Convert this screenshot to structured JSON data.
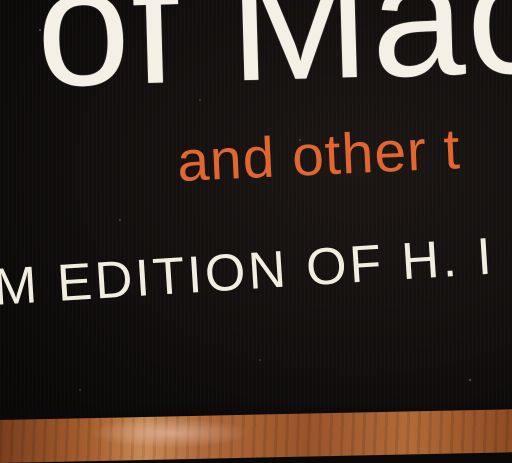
{
  "photo": {
    "title_fragment": "of Mac",
    "subtitle_fragment": "and other t",
    "edition_fragment": "M EDITION OF H. I"
  },
  "colors": {
    "cover": "#110e0d",
    "title_text": "#f4f0e6",
    "subtitle_text": "#e2662f",
    "table": "#a8602f"
  }
}
